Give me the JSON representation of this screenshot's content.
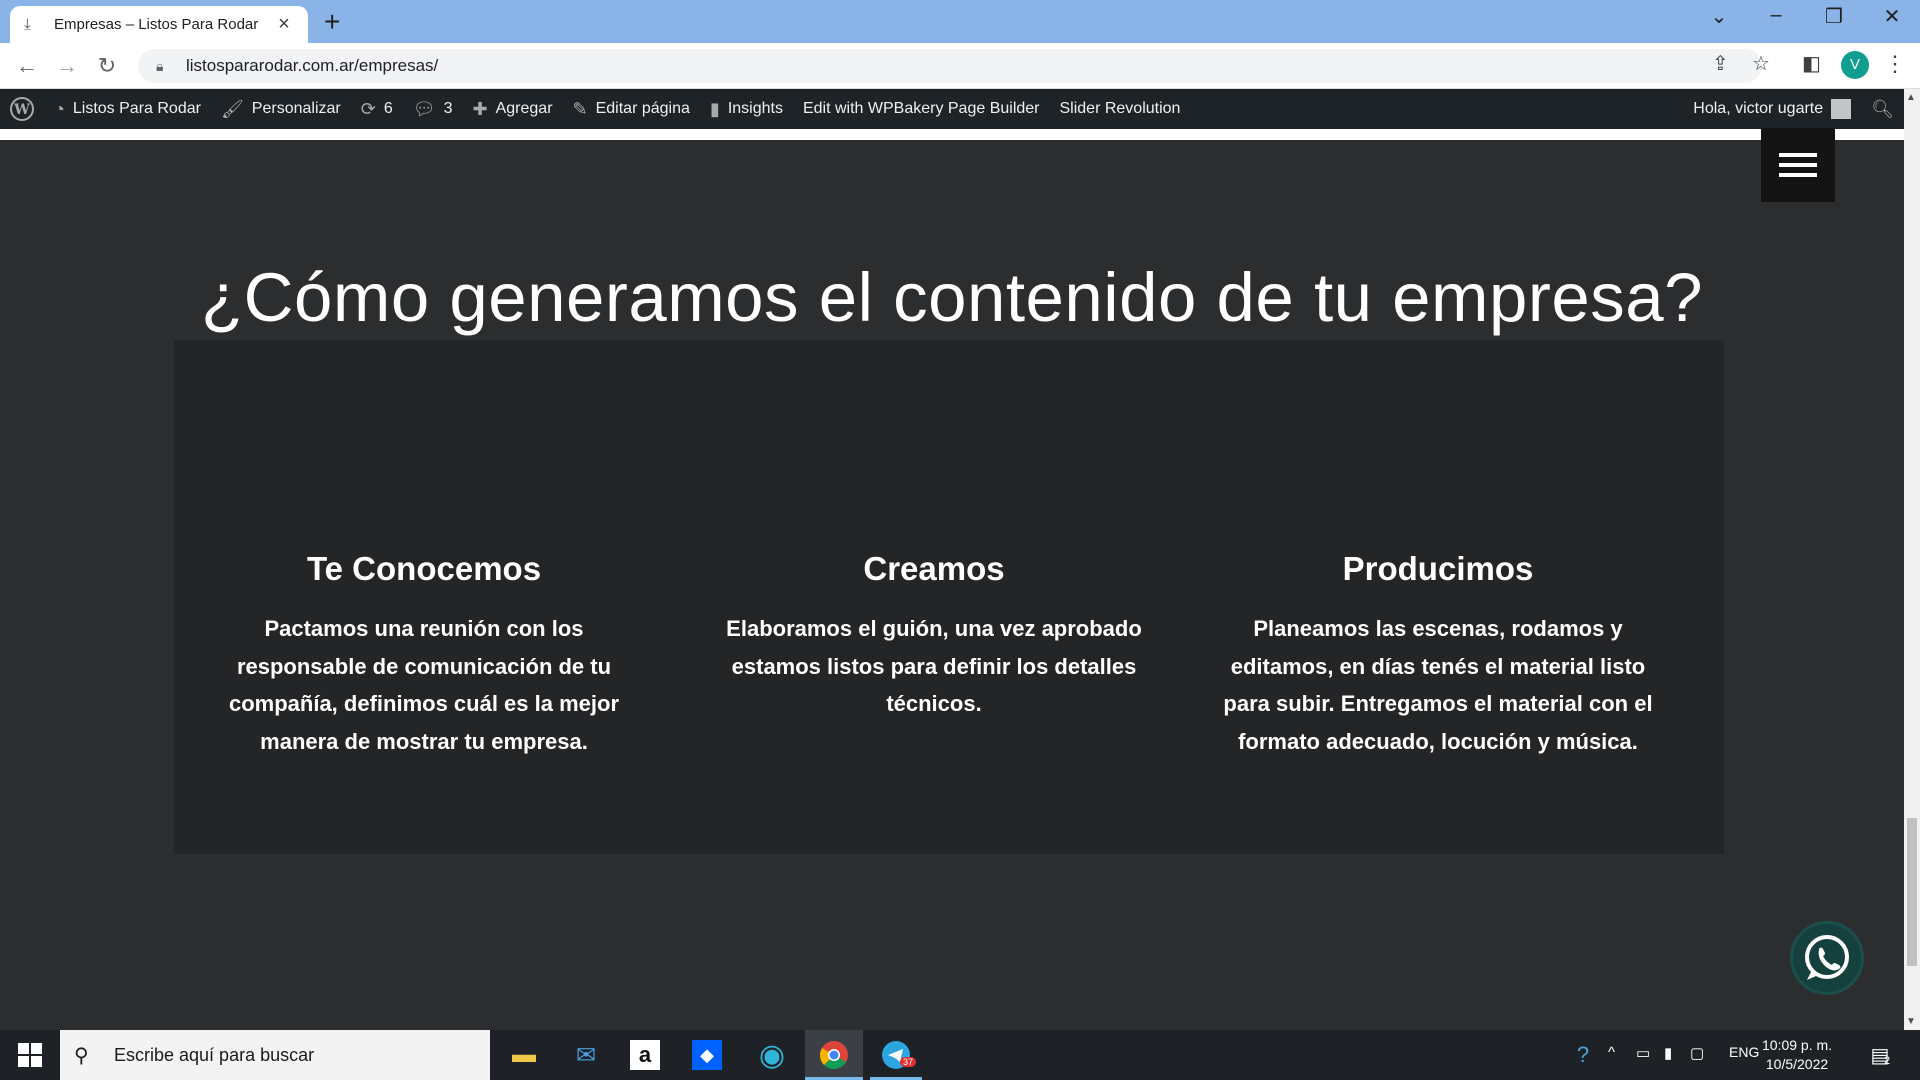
{
  "browser": {
    "tab_title": "Empresas – Listos Para Rodar",
    "url": "listospararodar.com.ar/empresas/",
    "profile_initial": "V"
  },
  "wp_admin_bar": {
    "site_name": "Listos Para Rodar",
    "customize": "Personalizar",
    "updates_count": "6",
    "comments_count": "3",
    "add_new": "Agregar",
    "edit_page": "Editar página",
    "insights": "Insights",
    "wpbakery": "Edit with WPBakery Page Builder",
    "slider_revolution": "Slider Revolution",
    "greeting": "Hola, victor ugarte"
  },
  "page": {
    "headline": "¿Cómo generamos el contenido de tu empresa?",
    "columns": [
      {
        "title": "Te Conocemos",
        "text": "Pactamos una reunión con los responsable de comunicación de tu compañía, definimos cuál es la mejor manera de mostrar tu empresa."
      },
      {
        "title": "Creamos",
        "text": "Elaboramos el guión, una vez aprobado estamos listos para definir los detalles técnicos."
      },
      {
        "title": "Producimos",
        "text": "Planeamos las escenas, rodamos y editamos, en días tenés el material listo para subir. Entregamos el material con el formato adecuado, locución y música."
      }
    ]
  },
  "taskbar": {
    "search_placeholder": "Escribe aquí para buscar",
    "telegram_badge": "37",
    "language": "ENG",
    "time": "10:09 p. m.",
    "date": "10/5/2022",
    "notifications_count": "2"
  },
  "colors": {
    "tab_strip": "#8ab4e8",
    "wp_bar": "#1d2327",
    "page_bg": "#2c2d2f",
    "panel_bg": "#242527",
    "whatsapp_bg": "#14403e"
  }
}
